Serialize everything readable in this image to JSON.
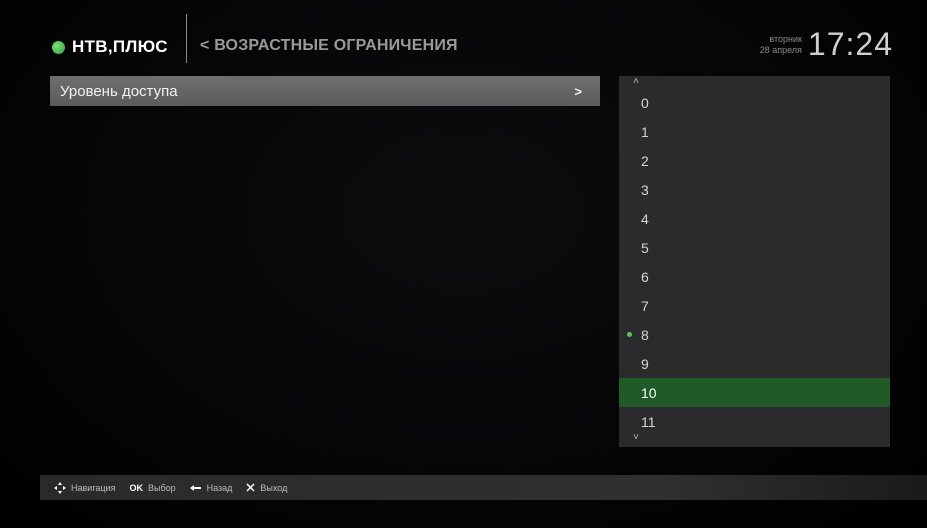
{
  "header": {
    "logo_text": "НТВ,ПЛЮС",
    "breadcrumb": "< ВОЗРАСТНЫЕ ОГРАНИЧЕНИЯ",
    "weekday": "вторник",
    "date": "28 апреля",
    "time": "17:24"
  },
  "menu": {
    "item_label": "Уровень доступа",
    "item_arrow": ">"
  },
  "list": {
    "scroll_up": "˄",
    "scroll_down": "˅",
    "items": [
      "0",
      "1",
      "2",
      "3",
      "4",
      "5",
      "6",
      "7",
      "8",
      "9",
      "10",
      "11"
    ],
    "selected_value": "8",
    "focused_value": "10"
  },
  "help": {
    "navigation": "Навигация",
    "ok_key": "OK",
    "ok_label": "Выбор",
    "back_label": "Назад",
    "exit_label": "Выход"
  },
  "colors": {
    "accent": "#1f5a27",
    "logo_dot": "#3fae45",
    "menu_bg": "#666667",
    "panel_bg": "#2a2b2c"
  }
}
